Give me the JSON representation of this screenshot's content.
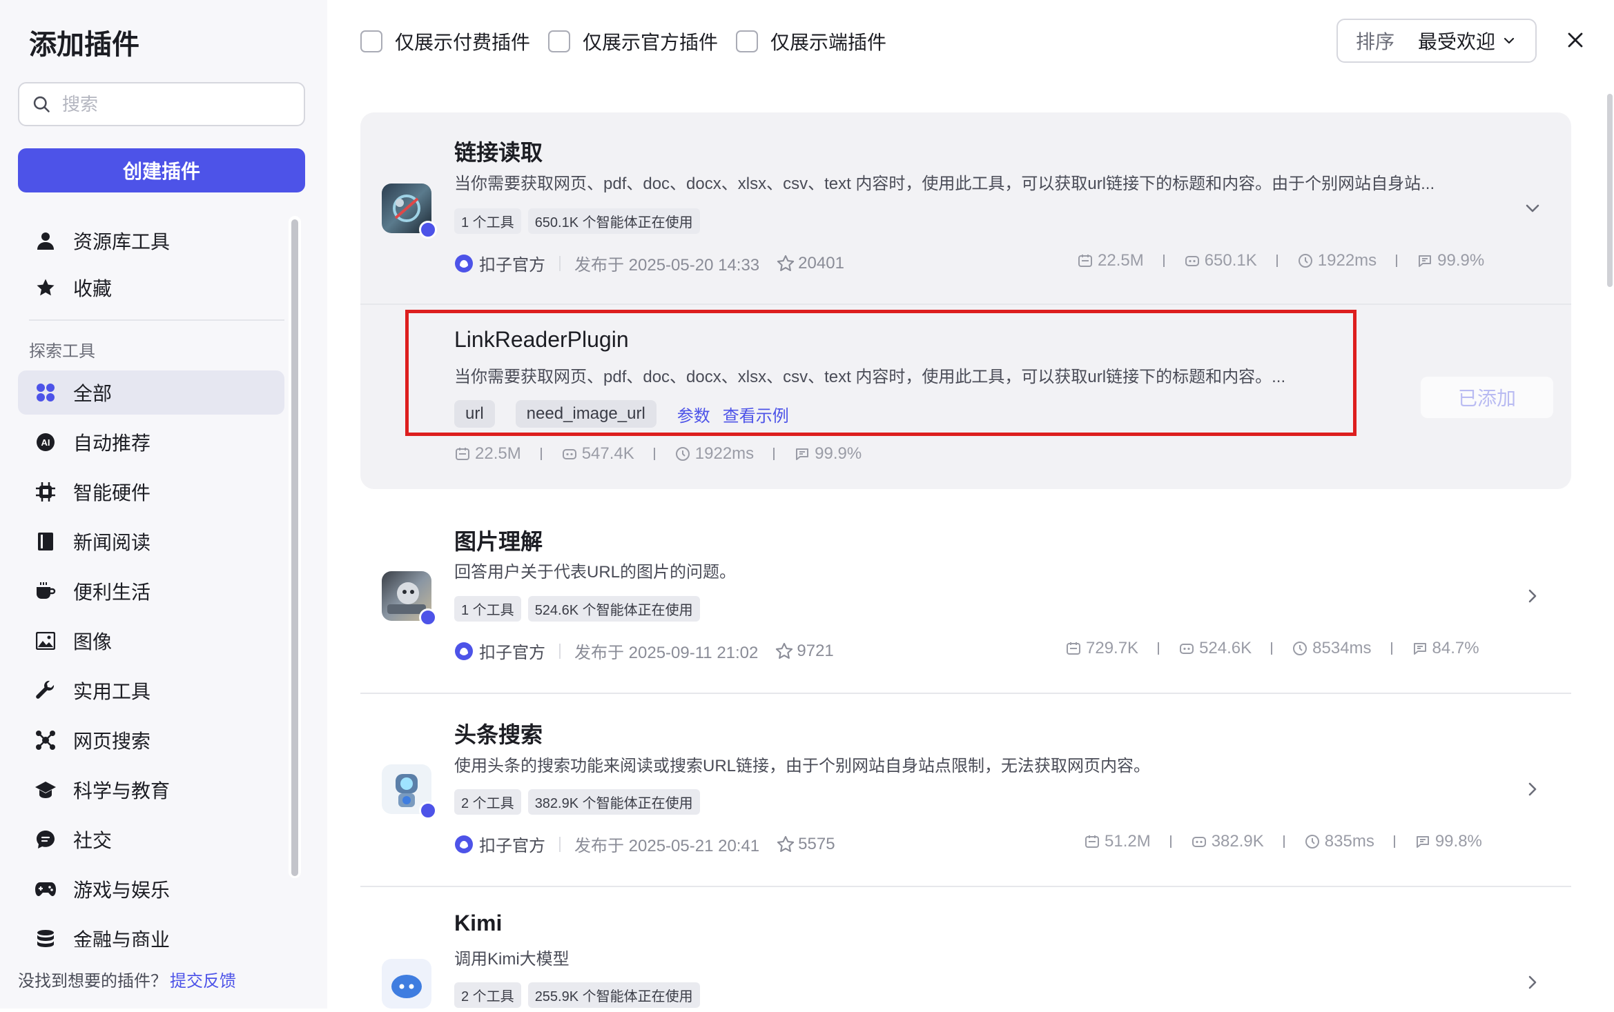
{
  "sidebar": {
    "title": "添加插件",
    "search_placeholder": "搜索",
    "create_button": "创建插件",
    "items_top": [
      {
        "label": "资源库工具",
        "icon": "user-icon"
      },
      {
        "label": "收藏",
        "icon": "star-icon"
      }
    ],
    "section_label": "探索工具",
    "categories": [
      {
        "label": "全部",
        "icon": "grid-icon",
        "active": true
      },
      {
        "label": "自动推荐",
        "icon": "ai-icon"
      },
      {
        "label": "智能硬件",
        "icon": "chip-icon"
      },
      {
        "label": "新闻阅读",
        "icon": "book-icon"
      },
      {
        "label": "便利生活",
        "icon": "cup-icon"
      },
      {
        "label": "图像",
        "icon": "image-icon"
      },
      {
        "label": "实用工具",
        "icon": "wrench-icon"
      },
      {
        "label": "网页搜索",
        "icon": "network-icon"
      },
      {
        "label": "科学与教育",
        "icon": "graduation-cap-icon"
      },
      {
        "label": "社交",
        "icon": "chat-icon"
      },
      {
        "label": "游戏与娱乐",
        "icon": "gamepad-icon"
      },
      {
        "label": "金融与商业",
        "icon": "database-icon"
      }
    ],
    "feedback_text": "没找到想要的插件？",
    "feedback_link": "提交反馈"
  },
  "topbar": {
    "filters": [
      "仅展示付费插件",
      "仅展示官方插件",
      "仅展示端插件"
    ],
    "sort_label": "排序",
    "sort_value": "最受欢迎"
  },
  "plugins": [
    {
      "name": "链接读取",
      "description": "当你需要获取网页、pdf、doc、docx、xlsx、csv、text 内容时，使用此工具，可以获取url链接下的标题和内容。由于个别网站自身站...",
      "tool_count": "1 个工具",
      "usage": "650.1K 个智能体正在使用",
      "publisher": "扣子官方",
      "published": "发布于 2025-05-20 14:33",
      "stars": "20401",
      "stats": {
        "calls": "22.5M",
        "bots": "650.1K",
        "latency": "1922ms",
        "success": "99.9%"
      }
    },
    {
      "name": "图片理解",
      "description": "回答用户关于代表URL的图片的问题。",
      "tool_count": "1 个工具",
      "usage": "524.6K 个智能体正在使用",
      "publisher": "扣子官方",
      "published": "发布于 2025-09-11 21:02",
      "stars": "9721",
      "stats": {
        "calls": "729.7K",
        "bots": "524.6K",
        "latency": "8534ms",
        "success": "84.7%"
      }
    },
    {
      "name": "头条搜索",
      "description": "使用头条的搜索功能来阅读或搜索URL链接，由于个别网站自身站点限制，无法获取网页内容。",
      "tool_count": "2 个工具",
      "usage": "382.9K 个智能体正在使用",
      "publisher": "扣子官方",
      "published": "发布于 2025-05-21 20:41",
      "stars": "5575",
      "stats": {
        "calls": "51.2M",
        "bots": "382.9K",
        "latency": "835ms",
        "success": "99.8%"
      }
    },
    {
      "name": "Kimi",
      "description": "调用Kimi大模型",
      "tool_count": "2 个工具",
      "usage": "255.9K 个智能体正在使用"
    }
  ],
  "tool": {
    "name": "LinkReaderPlugin",
    "description": "当你需要获取网页、pdf、doc、docx、xlsx、csv、text 内容时，使用此工具，可以获取url链接下的标题和内容。...",
    "params": [
      "url",
      "need_image_url"
    ],
    "params_link": "参数",
    "example_link": "查看示例",
    "stats": {
      "calls": "22.5M",
      "bots": "547.4K",
      "latency": "1922ms",
      "success": "99.9%"
    },
    "added_label": "已添加"
  },
  "colors": {
    "accent": "#4d53e8",
    "highlight": "#dd1f1f"
  }
}
